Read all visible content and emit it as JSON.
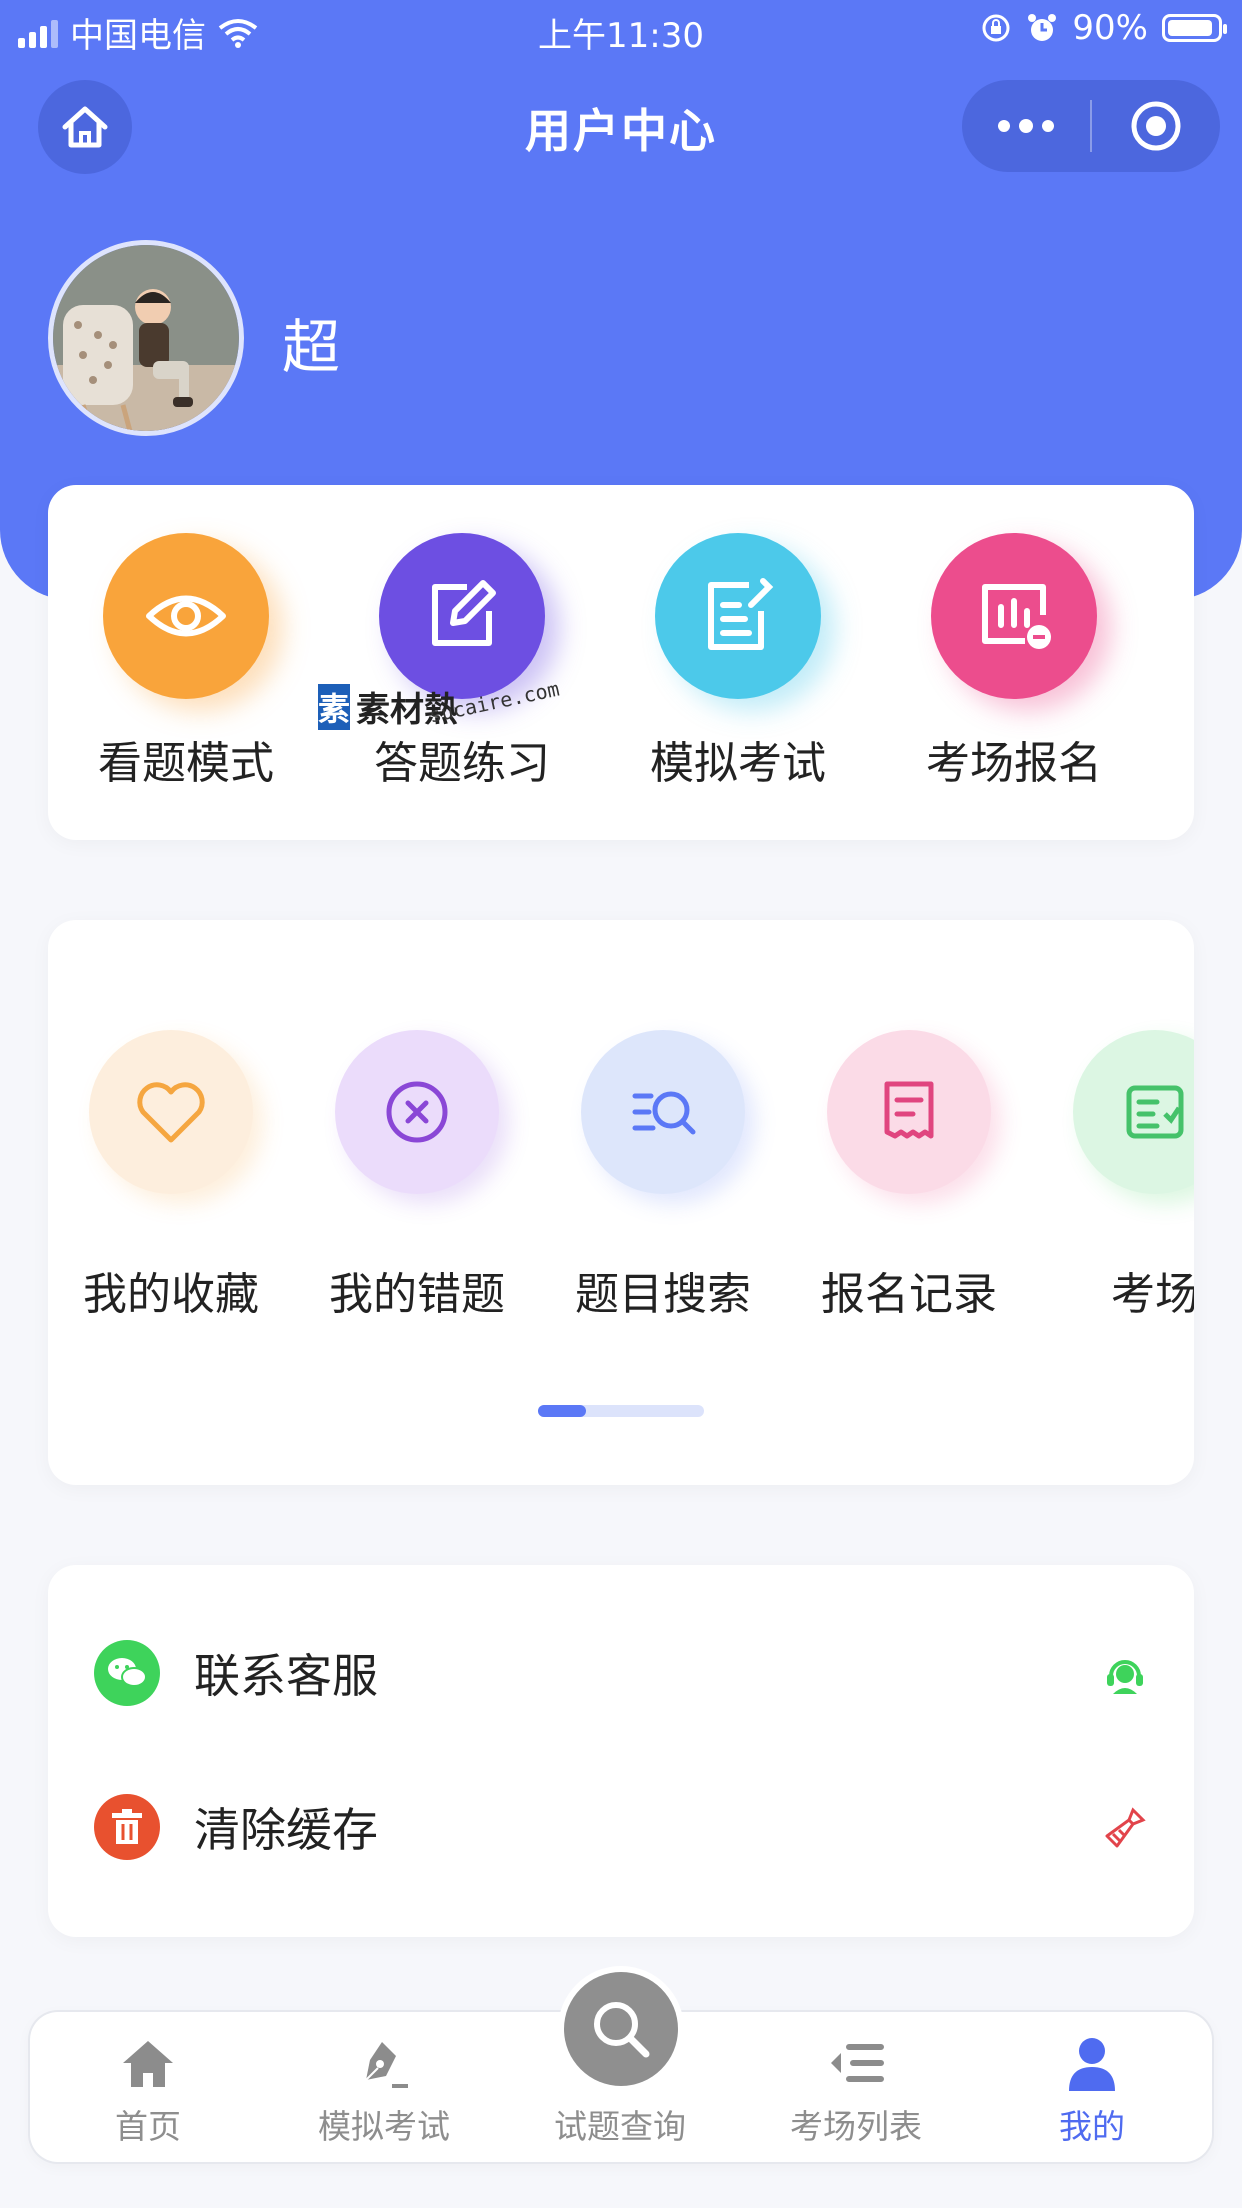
{
  "status_bar": {
    "carrier": "中国电信",
    "time": "上午11:30",
    "battery": "90%",
    "battery_level": 0.9
  },
  "nav": {
    "title": "用户中心"
  },
  "user": {
    "name": "超"
  },
  "colors": {
    "primary": "#5b78f6",
    "orange": "#f9a43b",
    "purple": "#6d4fe2",
    "cyan": "#4cc9ea",
    "pink": "#ec4d8d",
    "green": "#3ed35b",
    "red": "#e8512f"
  },
  "quick_actions": [
    {
      "label": "看题模式",
      "icon": "eye-icon"
    },
    {
      "label": "答题练习",
      "icon": "edit-icon"
    },
    {
      "label": "模拟考试",
      "icon": "document-edit-icon"
    },
    {
      "label": "考场报名",
      "icon": "chart-minus-icon"
    }
  ],
  "features": [
    {
      "label": "我的收藏",
      "icon": "heart-icon"
    },
    {
      "label": "我的错题",
      "icon": "close-circle-icon"
    },
    {
      "label": "题目搜索",
      "icon": "search-list-icon"
    },
    {
      "label": "报名记录",
      "icon": "receipt-icon"
    },
    {
      "label": "考场",
      "icon": "list-check-icon"
    }
  ],
  "menu": [
    {
      "label": "联系客服",
      "icon": "wechat-icon",
      "right_icon": "customer-service-icon"
    },
    {
      "label": "清除缓存",
      "icon": "trash-icon",
      "right_icon": "broom-icon"
    }
  ],
  "tabbar": [
    {
      "label": "首页",
      "icon": "home-icon"
    },
    {
      "label": "模拟考试",
      "icon": "pen-icon"
    },
    {
      "label": "试题查询",
      "icon": "search-icon"
    },
    {
      "label": "考场列表",
      "icon": "list-icon"
    },
    {
      "label": "我的",
      "icon": "user-icon",
      "active": true
    }
  ],
  "watermark": {
    "brand": "素材熱",
    "url": "sucaire.com"
  }
}
